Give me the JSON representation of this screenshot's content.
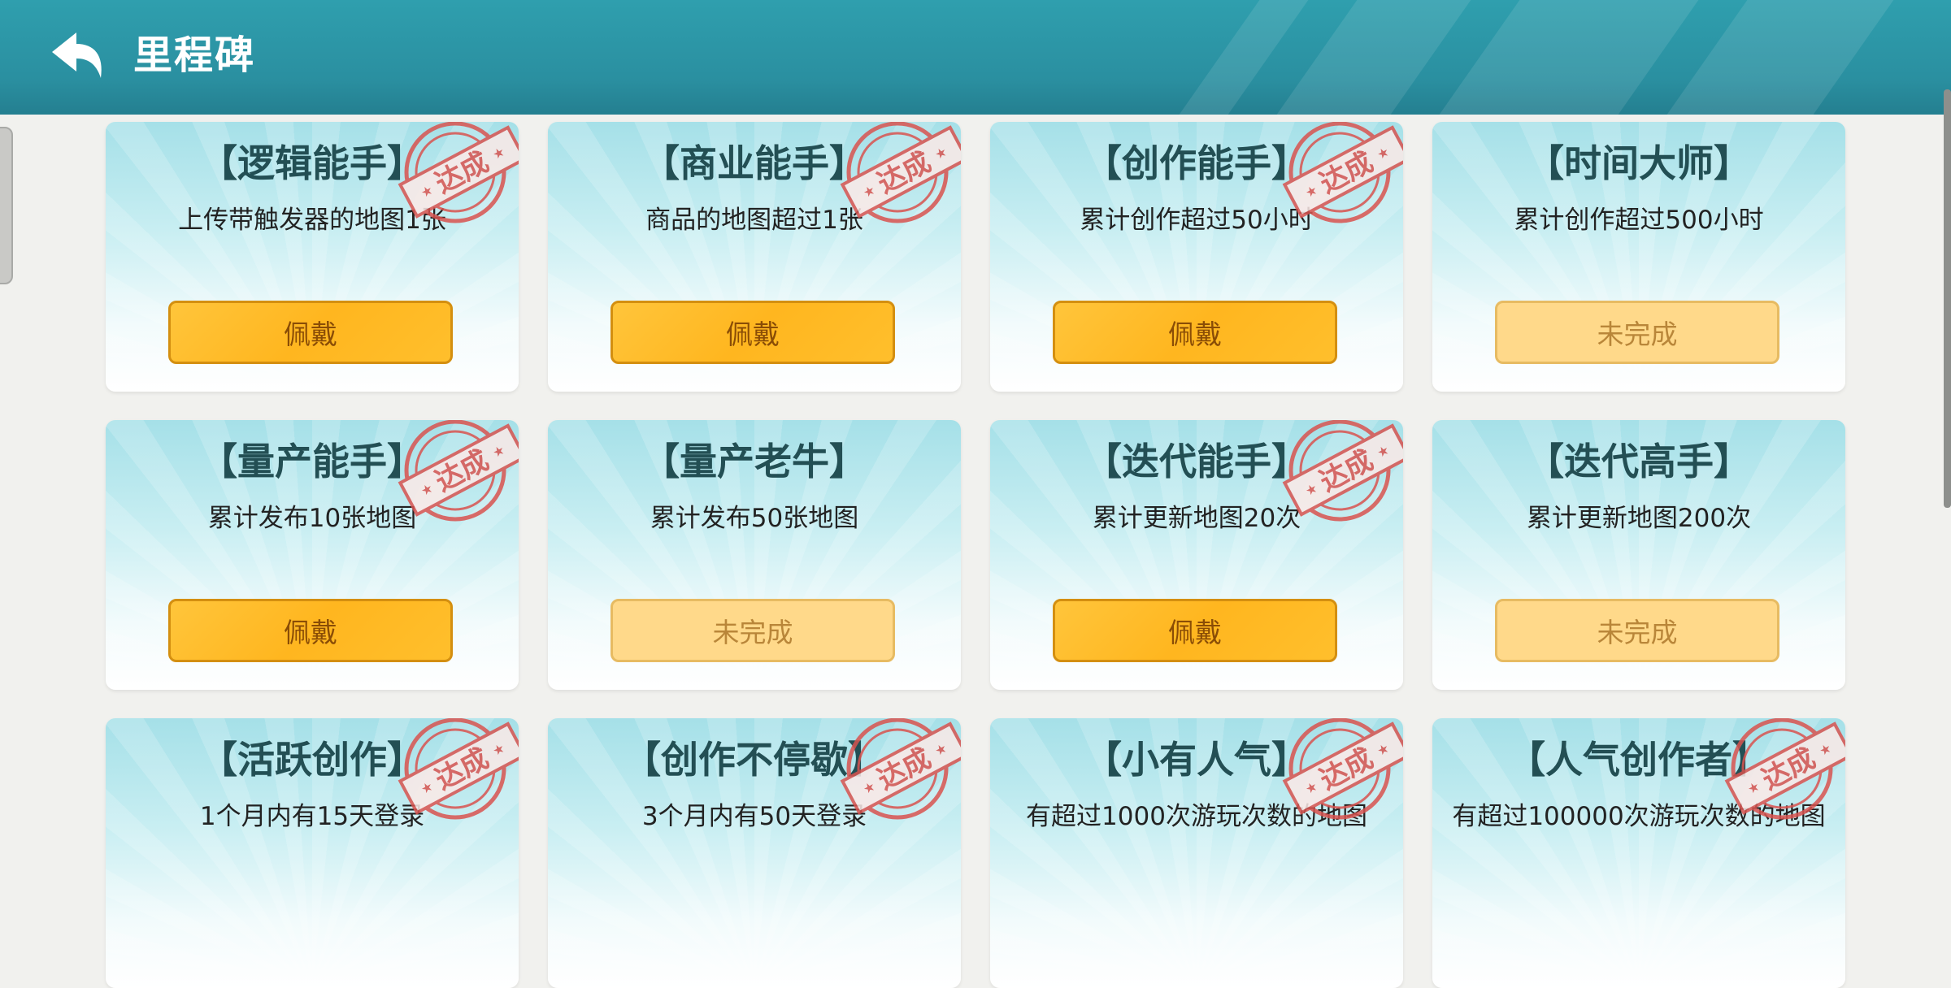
{
  "header": {
    "title": "里程碑",
    "back_icon": "back-arrow-icon"
  },
  "stamp_text": "达成",
  "cards": [
    {
      "name": "【逻辑能手】",
      "desc": "上传带触发器的地图1张",
      "button": "佩戴",
      "achieved": true
    },
    {
      "name": "【商业能手】",
      "desc": "商品的地图超过1张",
      "button": "佩戴",
      "achieved": true
    },
    {
      "name": "【创作能手】",
      "desc": "累计创作超过50小时",
      "button": "佩戴",
      "achieved": true
    },
    {
      "name": "【时间大师】",
      "desc": "累计创作超过500小时",
      "button": "未完成",
      "achieved": false
    },
    {
      "name": "【量产能手】",
      "desc": "累计发布10张地图",
      "button": "佩戴",
      "achieved": true
    },
    {
      "name": "【量产老牛】",
      "desc": "累计发布50张地图",
      "button": "未完成",
      "achieved": false
    },
    {
      "name": "【迭代能手】",
      "desc": "累计更新地图20次",
      "button": "佩戴",
      "achieved": true
    },
    {
      "name": "【迭代高手】",
      "desc": "累计更新地图200次",
      "button": "未完成",
      "achieved": false
    },
    {
      "name": "【活跃创作】",
      "desc": "1个月内有15天登录",
      "button": "",
      "achieved": true
    },
    {
      "name": "【创作不停歇】",
      "desc": "3个月内有50天登录",
      "button": "",
      "achieved": true
    },
    {
      "name": "【小有人气】",
      "desc": "有超过1000次游玩次数的地图",
      "button": "",
      "achieved": true
    },
    {
      "name": "【人气创作者】",
      "desc": "有超过100000次游玩次数的地图",
      "button": "",
      "achieved": true
    }
  ],
  "colors": {
    "header": "#2a8fa0",
    "button": "#ffb61f",
    "button_disabled": "#ffd98a",
    "stamp": "#d9534f"
  }
}
